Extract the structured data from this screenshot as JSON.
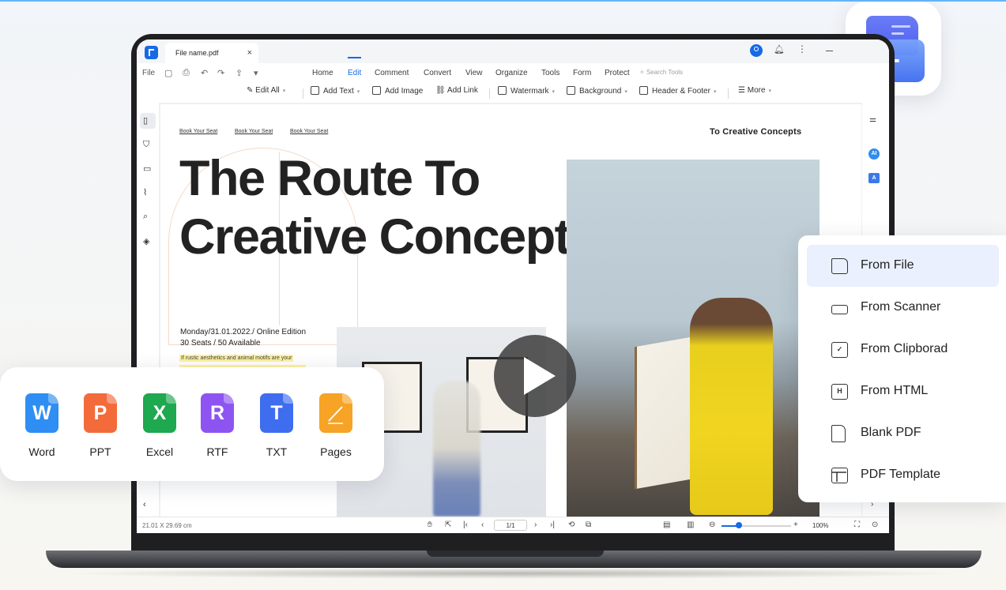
{
  "app": {
    "tab_title": "File name.pdf",
    "tab_close": "×"
  },
  "menubar": {
    "file": "File",
    "items": [
      "Home",
      "Edit",
      "Comment",
      "Convert",
      "View",
      "Organize",
      "Tools",
      "Form",
      "Protect"
    ],
    "active": "Edit",
    "search_placeholder": "Search Tools"
  },
  "toolbar": {
    "edit_all": "Edit All",
    "add_text": "Add Text",
    "add_image": "Add Image",
    "add_link": "Add Link",
    "watermark": "Watermark",
    "background": "Background",
    "header_footer": "Header & Footer",
    "more": "More"
  },
  "document": {
    "links": [
      "Book Your Seat",
      "Book Your Seat",
      "Book Your Seat"
    ],
    "header_right": "To Creative Concepts",
    "title_line1": "The Route To",
    "title_line2": "Creative Concepts",
    "date_line": "Monday/31.01.2022./ Online Edition",
    "seats_line": "30 Seats / 50 Available",
    "highlight_text": "If rustic aesthetics and animal motifs are your"
  },
  "statusbar": {
    "page_size": "21.01 X 29.69 cm",
    "page_indicator": "1/1",
    "zoom": "100%",
    "zoom_fraction": 0.25
  },
  "formats": [
    {
      "label": "Word",
      "letter": "W",
      "color": "#2f8ef3"
    },
    {
      "label": "PPT",
      "letter": "P",
      "color": "#f36b3a"
    },
    {
      "label": "Excel",
      "letter": "X",
      "color": "#1ea84f"
    },
    {
      "label": "RTF",
      "letter": "R",
      "color": "#8e54f2"
    },
    {
      "label": "TXT",
      "letter": "T",
      "color": "#3f6df0"
    },
    {
      "label": "Pages",
      "letter": "",
      "color": "#f6a326"
    }
  ],
  "create_menu": {
    "items": [
      {
        "label": "From File",
        "icon": "folder-icon"
      },
      {
        "label": "From Scanner",
        "icon": "scanner-icon"
      },
      {
        "label": "From Clipborad",
        "icon": "clipboard-icon"
      },
      {
        "label": "From HTML",
        "icon": "html-icon"
      },
      {
        "label": "Blank PDF",
        "icon": "blank-page-icon"
      },
      {
        "label": "PDF Template",
        "icon": "template-icon"
      }
    ],
    "highlighted_index": 0
  },
  "colors": {
    "accent": "#1669e6",
    "menu_highlight": "#eaf0fd"
  }
}
